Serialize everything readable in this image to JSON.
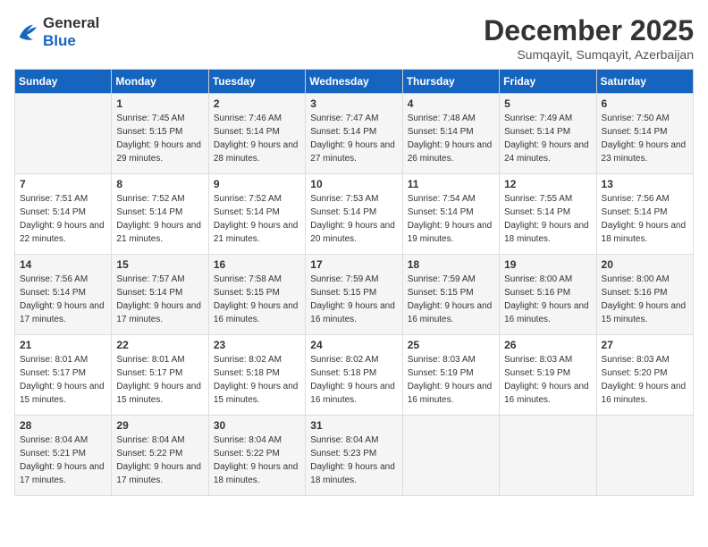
{
  "logo": {
    "line1": "General",
    "line2": "Blue"
  },
  "title": "December 2025",
  "subtitle": "Sumqayit, Sumqayit, Azerbaijan",
  "days_of_week": [
    "Sunday",
    "Monday",
    "Tuesday",
    "Wednesday",
    "Thursday",
    "Friday",
    "Saturday"
  ],
  "weeks": [
    [
      {
        "day": "",
        "sunrise": "",
        "sunset": "",
        "daylight": ""
      },
      {
        "day": "1",
        "sunrise": "Sunrise: 7:45 AM",
        "sunset": "Sunset: 5:15 PM",
        "daylight": "Daylight: 9 hours and 29 minutes."
      },
      {
        "day": "2",
        "sunrise": "Sunrise: 7:46 AM",
        "sunset": "Sunset: 5:14 PM",
        "daylight": "Daylight: 9 hours and 28 minutes."
      },
      {
        "day": "3",
        "sunrise": "Sunrise: 7:47 AM",
        "sunset": "Sunset: 5:14 PM",
        "daylight": "Daylight: 9 hours and 27 minutes."
      },
      {
        "day": "4",
        "sunrise": "Sunrise: 7:48 AM",
        "sunset": "Sunset: 5:14 PM",
        "daylight": "Daylight: 9 hours and 26 minutes."
      },
      {
        "day": "5",
        "sunrise": "Sunrise: 7:49 AM",
        "sunset": "Sunset: 5:14 PM",
        "daylight": "Daylight: 9 hours and 24 minutes."
      },
      {
        "day": "6",
        "sunrise": "Sunrise: 7:50 AM",
        "sunset": "Sunset: 5:14 PM",
        "daylight": "Daylight: 9 hours and 23 minutes."
      }
    ],
    [
      {
        "day": "7",
        "sunrise": "Sunrise: 7:51 AM",
        "sunset": "Sunset: 5:14 PM",
        "daylight": "Daylight: 9 hours and 22 minutes."
      },
      {
        "day": "8",
        "sunrise": "Sunrise: 7:52 AM",
        "sunset": "Sunset: 5:14 PM",
        "daylight": "Daylight: 9 hours and 21 minutes."
      },
      {
        "day": "9",
        "sunrise": "Sunrise: 7:52 AM",
        "sunset": "Sunset: 5:14 PM",
        "daylight": "Daylight: 9 hours and 21 minutes."
      },
      {
        "day": "10",
        "sunrise": "Sunrise: 7:53 AM",
        "sunset": "Sunset: 5:14 PM",
        "daylight": "Daylight: 9 hours and 20 minutes."
      },
      {
        "day": "11",
        "sunrise": "Sunrise: 7:54 AM",
        "sunset": "Sunset: 5:14 PM",
        "daylight": "Daylight: 9 hours and 19 minutes."
      },
      {
        "day": "12",
        "sunrise": "Sunrise: 7:55 AM",
        "sunset": "Sunset: 5:14 PM",
        "daylight": "Daylight: 9 hours and 18 minutes."
      },
      {
        "day": "13",
        "sunrise": "Sunrise: 7:56 AM",
        "sunset": "Sunset: 5:14 PM",
        "daylight": "Daylight: 9 hours and 18 minutes."
      }
    ],
    [
      {
        "day": "14",
        "sunrise": "Sunrise: 7:56 AM",
        "sunset": "Sunset: 5:14 PM",
        "daylight": "Daylight: 9 hours and 17 minutes."
      },
      {
        "day": "15",
        "sunrise": "Sunrise: 7:57 AM",
        "sunset": "Sunset: 5:14 PM",
        "daylight": "Daylight: 9 hours and 17 minutes."
      },
      {
        "day": "16",
        "sunrise": "Sunrise: 7:58 AM",
        "sunset": "Sunset: 5:15 PM",
        "daylight": "Daylight: 9 hours and 16 minutes."
      },
      {
        "day": "17",
        "sunrise": "Sunrise: 7:59 AM",
        "sunset": "Sunset: 5:15 PM",
        "daylight": "Daylight: 9 hours and 16 minutes."
      },
      {
        "day": "18",
        "sunrise": "Sunrise: 7:59 AM",
        "sunset": "Sunset: 5:15 PM",
        "daylight": "Daylight: 9 hours and 16 minutes."
      },
      {
        "day": "19",
        "sunrise": "Sunrise: 8:00 AM",
        "sunset": "Sunset: 5:16 PM",
        "daylight": "Daylight: 9 hours and 16 minutes."
      },
      {
        "day": "20",
        "sunrise": "Sunrise: 8:00 AM",
        "sunset": "Sunset: 5:16 PM",
        "daylight": "Daylight: 9 hours and 15 minutes."
      }
    ],
    [
      {
        "day": "21",
        "sunrise": "Sunrise: 8:01 AM",
        "sunset": "Sunset: 5:17 PM",
        "daylight": "Daylight: 9 hours and 15 minutes."
      },
      {
        "day": "22",
        "sunrise": "Sunrise: 8:01 AM",
        "sunset": "Sunset: 5:17 PM",
        "daylight": "Daylight: 9 hours and 15 minutes."
      },
      {
        "day": "23",
        "sunrise": "Sunrise: 8:02 AM",
        "sunset": "Sunset: 5:18 PM",
        "daylight": "Daylight: 9 hours and 15 minutes."
      },
      {
        "day": "24",
        "sunrise": "Sunrise: 8:02 AM",
        "sunset": "Sunset: 5:18 PM",
        "daylight": "Daylight: 9 hours and 16 minutes."
      },
      {
        "day": "25",
        "sunrise": "Sunrise: 8:03 AM",
        "sunset": "Sunset: 5:19 PM",
        "daylight": "Daylight: 9 hours and 16 minutes."
      },
      {
        "day": "26",
        "sunrise": "Sunrise: 8:03 AM",
        "sunset": "Sunset: 5:19 PM",
        "daylight": "Daylight: 9 hours and 16 minutes."
      },
      {
        "day": "27",
        "sunrise": "Sunrise: 8:03 AM",
        "sunset": "Sunset: 5:20 PM",
        "daylight": "Daylight: 9 hours and 16 minutes."
      }
    ],
    [
      {
        "day": "28",
        "sunrise": "Sunrise: 8:04 AM",
        "sunset": "Sunset: 5:21 PM",
        "daylight": "Daylight: 9 hours and 17 minutes."
      },
      {
        "day": "29",
        "sunrise": "Sunrise: 8:04 AM",
        "sunset": "Sunset: 5:22 PM",
        "daylight": "Daylight: 9 hours and 17 minutes."
      },
      {
        "day": "30",
        "sunrise": "Sunrise: 8:04 AM",
        "sunset": "Sunset: 5:22 PM",
        "daylight": "Daylight: 9 hours and 18 minutes."
      },
      {
        "day": "31",
        "sunrise": "Sunrise: 8:04 AM",
        "sunset": "Sunset: 5:23 PM",
        "daylight": "Daylight: 9 hours and 18 minutes."
      },
      {
        "day": "",
        "sunrise": "",
        "sunset": "",
        "daylight": ""
      },
      {
        "day": "",
        "sunrise": "",
        "sunset": "",
        "daylight": ""
      },
      {
        "day": "",
        "sunrise": "",
        "sunset": "",
        "daylight": ""
      }
    ]
  ]
}
